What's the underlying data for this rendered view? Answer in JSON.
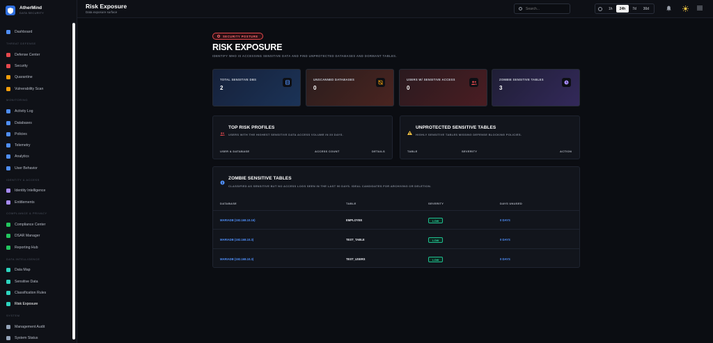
{
  "app": {
    "name": "AtherMind",
    "tagline": "DATA SECURITY"
  },
  "header": {
    "title": "Risk Exposure",
    "subtitle": "Data exposure surface"
  },
  "search": {
    "placeholder": "Search..."
  },
  "time_ranges": [
    "1h",
    "24h",
    "7d",
    "30d"
  ],
  "time_range_selected": "24h",
  "icons": {
    "notifications": "bell-icon",
    "theme": "sun-icon",
    "menu": "hamburger-icon"
  },
  "sidebar": {
    "items": [
      {
        "type": "item",
        "label": "Dashboard",
        "icon": "home-icon",
        "color": "#4f8ef7"
      },
      {
        "type": "section",
        "label": "Threat Defense"
      },
      {
        "type": "item",
        "label": "Defense Center",
        "icon": "rocket-icon",
        "color": "#e5484d"
      },
      {
        "type": "item",
        "label": "Security",
        "icon": "shield-icon",
        "color": "#e5484d"
      },
      {
        "type": "item",
        "label": "Quarantine",
        "icon": "ban-icon",
        "color": "#f59e0b"
      },
      {
        "type": "item",
        "label": "Vulnerability Scan",
        "icon": "bug-icon",
        "color": "#f59e0b"
      },
      {
        "type": "section",
        "label": "Monitoring"
      },
      {
        "type": "item",
        "label": "Activity Log",
        "icon": "list-icon",
        "color": "#4f8ef7"
      },
      {
        "type": "item",
        "label": "Databases",
        "icon": "database-icon",
        "color": "#4f8ef7"
      },
      {
        "type": "item",
        "label": "Policies",
        "icon": "shield-icon",
        "color": "#4f8ef7"
      },
      {
        "type": "item",
        "label": "Telemetry",
        "icon": "signal-icon",
        "color": "#4f8ef7"
      },
      {
        "type": "item",
        "label": "Analytics",
        "icon": "chart-icon",
        "color": "#4f8ef7"
      },
      {
        "type": "item",
        "label": "User Behavior",
        "icon": "users-icon",
        "color": "#4f8ef7"
      },
      {
        "type": "section",
        "label": "Identity & Access"
      },
      {
        "type": "item",
        "label": "Identity Intelligence",
        "icon": "fingerprint-icon",
        "color": "#a78bfa"
      },
      {
        "type": "item",
        "label": "Entitlements",
        "icon": "key-icon",
        "color": "#a78bfa"
      },
      {
        "type": "section",
        "label": "Compliance & Privacy"
      },
      {
        "type": "item",
        "label": "Compliance Center",
        "icon": "document-icon",
        "color": "#22c55e"
      },
      {
        "type": "item",
        "label": "DSAR Manager",
        "icon": "search-icon",
        "color": "#22c55e"
      },
      {
        "type": "item",
        "label": "Reporting Hub",
        "icon": "trend-icon",
        "color": "#22c55e"
      },
      {
        "type": "section",
        "label": "Data Intelligence"
      },
      {
        "type": "item",
        "label": "Data Map",
        "icon": "map-icon",
        "color": "#2dd4bf"
      },
      {
        "type": "item",
        "label": "Sensitive Data",
        "icon": "eye-icon",
        "color": "#2dd4bf"
      },
      {
        "type": "item",
        "label": "Classification Rules",
        "icon": "rules-icon",
        "color": "#2dd4bf"
      },
      {
        "type": "item",
        "label": "Risk Exposure",
        "icon": "pulse-icon",
        "color": "#2dd4bf"
      },
      {
        "type": "section",
        "label": "System"
      },
      {
        "type": "item",
        "label": "Management Audit",
        "icon": "document-icon",
        "color": "#94a3b8"
      },
      {
        "type": "item",
        "label": "System Status",
        "icon": "status-icon",
        "color": "#94a3b8"
      }
    ]
  },
  "hero": {
    "badge": "SECURITY POSTURE",
    "title": "RISK EXPOSURE",
    "subtitle": "IDENTIFY WHO IS ACCESSING SENSITIVE DATA AND FIND UNPROTECTED DATABASES AND DORMANT TABLES."
  },
  "stats": [
    {
      "label": "TOTAL SENSITIVE DBS",
      "value": "2",
      "icon": "database-icon",
      "icon_color": "#4f8ef7"
    },
    {
      "label": "UNSCANNED DATABASES",
      "value": "0",
      "icon": "eye-off-icon",
      "icon_color": "#f59e0b"
    },
    {
      "label": "USERS W/ SENSITIVE ACCESS",
      "value": "0",
      "icon": "users-icon",
      "icon_color": "#e5484d"
    },
    {
      "label": "ZOMBIE SENSITIVE TABLES",
      "value": "3",
      "icon": "clock-icon",
      "icon_color": "#a78bfa"
    }
  ],
  "top_risk": {
    "title": "TOP RISK PROFILES",
    "subtitle": "USERS WITH THE HIGHEST SENSITIVE DATA ACCESS VOLUME IN 30 DAYS.",
    "columns": [
      "USER & DATABASE",
      "ACCESS COUNT",
      "DETAILS"
    ]
  },
  "unprotected": {
    "title": "UNPROTECTED SENSITIVE TABLES",
    "subtitle": "HIGHLY SENSITIVE TABLES MISSING DEFENSE BLOCKING POLICIES.",
    "columns": [
      "TABLE",
      "SEVERITY",
      "ACTION"
    ]
  },
  "zombie": {
    "title": "ZOMBIE SENSITIVE TABLES",
    "subtitle": "CLASSIFIED AS SENSITIVE BUT NO ACCESS LOGS SEEN IN THE LAST 90 DAYS. IDEAL CANDIDATES FOR ARCHIVING OR DELETION.",
    "columns": [
      "DATABASE",
      "TABLE",
      "SEVERITY",
      "DAYS UNUSED"
    ],
    "rows": [
      {
        "database": "MARIADB (192.168.10.16)",
        "table": "EMPLOYEE",
        "severity": "LOW",
        "days": "0 DAYS"
      },
      {
        "database": "MARIADB (192.168.10.3)",
        "table": "TEST_TABLE",
        "severity": "LOW",
        "days": "0 DAYS"
      },
      {
        "database": "MARIADB (192.168.10.3)",
        "table": "TEST_USERS",
        "severity": "LOW",
        "days": "0 DAYS"
      }
    ]
  }
}
